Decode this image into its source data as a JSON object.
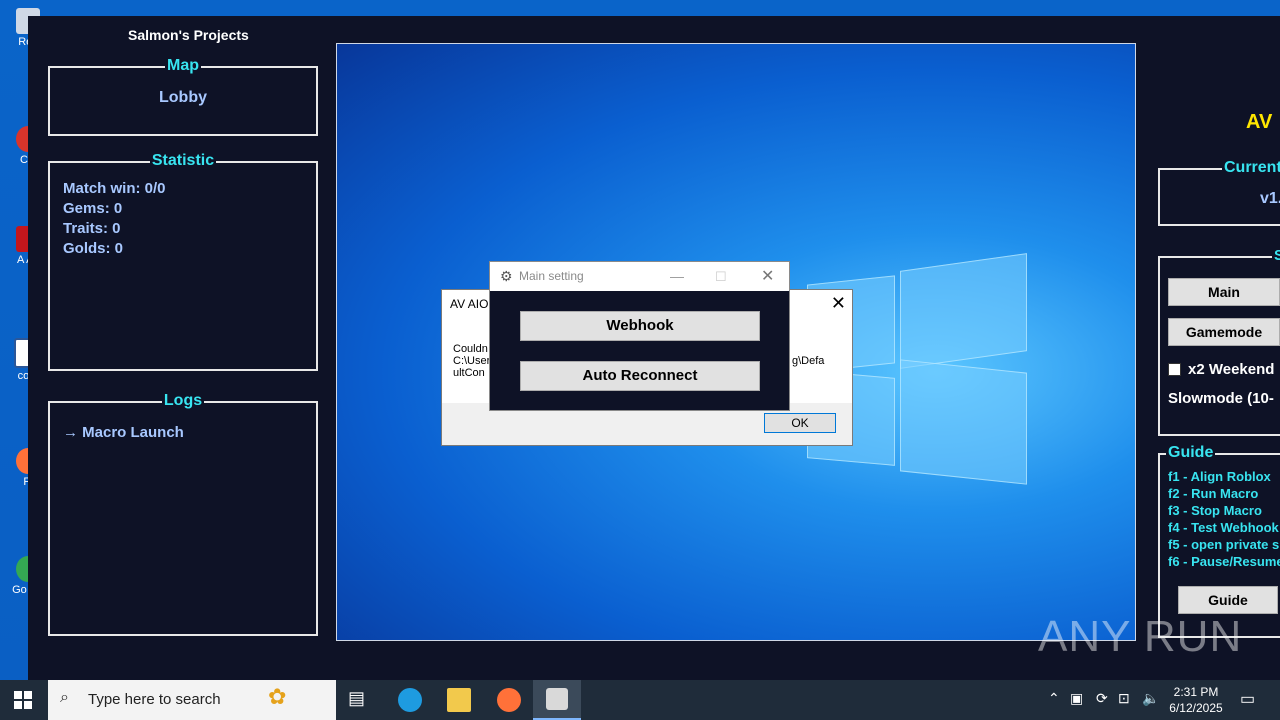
{
  "desktop": {
    "icons": [
      {
        "name": "recycle-bin-icon",
        "label": "Rec"
      },
      {
        "name": "ccleaner-icon",
        "label": "CC"
      },
      {
        "name": "acrobat-icon",
        "label": "A Ac"
      },
      {
        "name": "word-icon",
        "label": "com"
      },
      {
        "name": "firefox-desktop-icon",
        "label": "Fi"
      },
      {
        "name": "chrome-desktop-icon",
        "label": "Go Ch"
      }
    ]
  },
  "app": {
    "title": "Salmon's Projects",
    "map": {
      "legend": "Map",
      "value": "Lobby"
    },
    "statistic": {
      "legend": "Statistic",
      "lines": [
        "Match win: 0/0",
        "Gems: 0",
        "Traits: 0",
        "Golds: 0"
      ]
    },
    "logs": {
      "legend": "Logs",
      "entry": "→ Macro Launch"
    },
    "right": {
      "title": "AV",
      "current": {
        "legend": "Current",
        "value": "v1."
      },
      "settings": {
        "legend": "Sett",
        "main_btn": "Main",
        "gamemode_btn": "Gamemode",
        "weekend_label": "x2 Weekend",
        "slowmode_label": "Slowmode (10-"
      },
      "guide": {
        "legend": "Guide",
        "lines": [
          "f1  - Align Roblox",
          "f2  - Run Macro",
          "f3  - Stop Macro",
          "f4  - Test Webhook",
          "f5  - open private s",
          "f6  - Pause/Resume"
        ],
        "button": "Guide"
      }
    }
  },
  "error_dialog": {
    "title": "AV AIO.",
    "message_left": [
      "Couldn",
      "C:\\User",
      "ultCon"
    ],
    "message_right": "g\\Defa",
    "ok": "OK"
  },
  "main_dialog": {
    "title": "Main setting",
    "webhook": "Webhook",
    "auto_reconnect": "Auto Reconnect"
  },
  "watermark": "ANY RUN",
  "taskbar": {
    "search_placeholder": "Type here to search",
    "time": "2:31 PM",
    "date": "6/12/2025"
  }
}
